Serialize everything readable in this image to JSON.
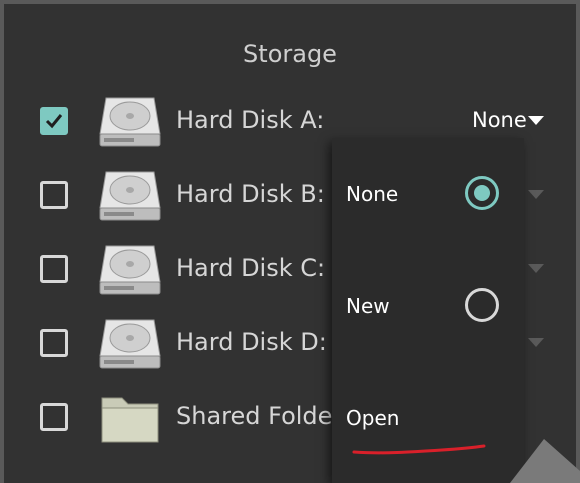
{
  "storage": {
    "title": "Storage",
    "rows": [
      {
        "label": "Hard Disk A:",
        "checked": true,
        "value": "None",
        "icon": "hard-disk-icon"
      },
      {
        "label": "Hard Disk B:",
        "checked": false,
        "icon": "hard-disk-icon"
      },
      {
        "label": "Hard Disk C:",
        "checked": false,
        "icon": "hard-disk-icon"
      },
      {
        "label": "Hard Disk D:",
        "checked": false,
        "icon": "hard-disk-icon"
      },
      {
        "label": "Shared Folde",
        "checked": false,
        "icon": "folder-icon"
      }
    ]
  },
  "dropdown": {
    "options": [
      {
        "label": "None",
        "selected": true
      },
      {
        "label": "New",
        "selected": false
      },
      {
        "label": "Open",
        "selected": false
      }
    ]
  },
  "colors": {
    "accent": "#7ec9c1",
    "panel": "#323232",
    "annotation": "#d9202a"
  }
}
